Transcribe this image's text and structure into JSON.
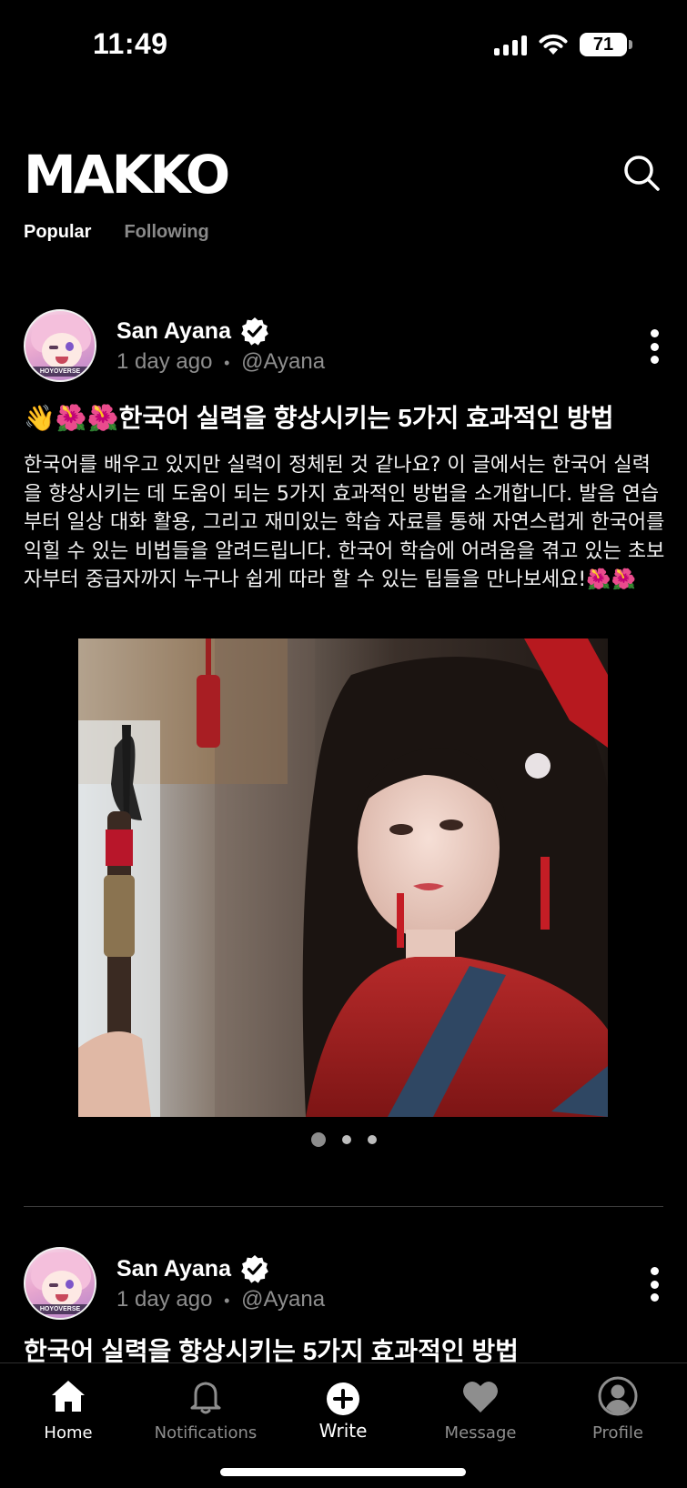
{
  "status_bar": {
    "time": "11:49",
    "battery": "71",
    "icons": [
      "signal-icon",
      "wifi-icon",
      "battery-icon"
    ]
  },
  "header": {
    "logo": "MAKKO",
    "search_icon": "search-icon"
  },
  "feed_tabs": [
    {
      "label": "Popular",
      "active": true
    },
    {
      "label": "Following",
      "active": false
    }
  ],
  "posts": [
    {
      "author": "San Ayana",
      "verified": true,
      "time": "1 day ago",
      "separator": "•",
      "handle": "@Ayana",
      "title": "👋🌺🌺한국어 실력을 향상시키는 5가지 효과적인 방법",
      "body": "한국어를 배우고 있지만 실력이 정체된 것 같나요? 이 글에서는 한국어 실력을 향상시키는 데 도움이 되는 5가지 효과적인 방법을 소개합니다. 발음 연습부터 일상 대화 활용, 그리고 재미있는 학습 자료를 통해 자연스럽게 한국어를 익힐 수 있는 비법들을 알려드립니다. 한국어 학습에 어려움을 겪고 있는 초보자부터 중급자까지 누구나 쉽게 따라 할 수 있는 팁들을 만나보세요!🌺🌺",
      "carousel": {
        "count": 3,
        "current": 1
      }
    },
    {
      "author": "San Ayana",
      "verified": true,
      "time": "1 day ago",
      "separator": "•",
      "handle": "@Ayana",
      "title": "한국어 실력을 향상시키는 5가지 효과적인 방법"
    }
  ],
  "avatar_brand": "HOYOVERSE",
  "tab_bar": {
    "items": [
      {
        "label": "Home",
        "icon": "home-icon",
        "active": true
      },
      {
        "label": "Notifications",
        "icon": "bell-icon",
        "active": false
      },
      {
        "label": "Write",
        "icon": "plus-circle-icon",
        "active": false
      },
      {
        "label": "Message",
        "icon": "heart-icon",
        "active": false
      },
      {
        "label": "Profile",
        "icon": "profile-icon",
        "active": false
      }
    ]
  }
}
